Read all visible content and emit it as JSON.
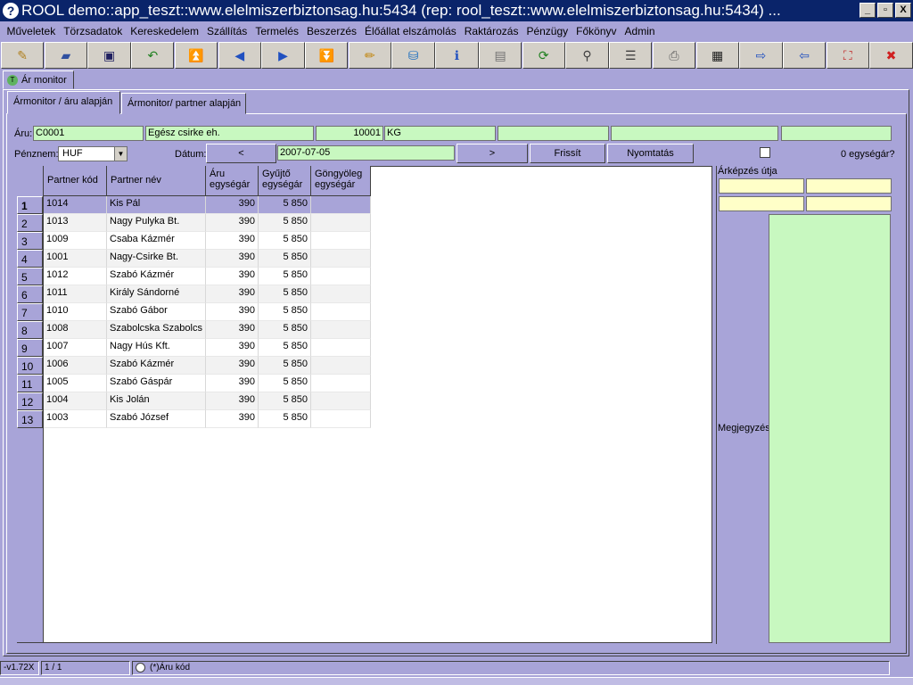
{
  "window": {
    "title": "ROOL demo::app_teszt::www.elelmiszerbiztonsag.hu:5434 (rep: rool_teszt::www.elelmiszerbiztonsag.hu:5434) ...",
    "app_icon": "?",
    "minimize": "_",
    "restore": "▫",
    "close": "X"
  },
  "menu": [
    "Műveletek",
    "Törzsadatok",
    "Kereskedelem",
    "Szállítás",
    "Termelés",
    "Beszerzés",
    "Élőállat elszámolás",
    "Raktározás",
    "Pénzügy",
    "Főkönyv",
    "Admin"
  ],
  "toolbar_icons": [
    {
      "name": "new-icon",
      "glyph": "✎",
      "color": "#b08020"
    },
    {
      "name": "open-icon",
      "glyph": "▰",
      "color": "#3050a0"
    },
    {
      "name": "save-icon",
      "glyph": "▣",
      "color": "#202060"
    },
    {
      "name": "undo-icon",
      "glyph": "↶",
      "color": "#208020"
    },
    {
      "name": "first-icon",
      "glyph": "⏫",
      "color": "#2050c0"
    },
    {
      "name": "prev-icon",
      "glyph": "◀",
      "color": "#2050c0"
    },
    {
      "name": "next-icon",
      "glyph": "▶",
      "color": "#2050c0"
    },
    {
      "name": "last-icon",
      "glyph": "⏬",
      "color": "#2050c0"
    },
    {
      "name": "edit-icon",
      "glyph": "✏",
      "color": "#c08000"
    },
    {
      "name": "database-icon",
      "glyph": "⛁",
      "color": "#2070c0"
    },
    {
      "name": "info-icon",
      "glyph": "ℹ",
      "color": "#2050c0"
    },
    {
      "name": "form-icon",
      "glyph": "▤",
      "color": "#707070"
    },
    {
      "name": "refresh-icon",
      "glyph": "⟳",
      "color": "#208020"
    },
    {
      "name": "search-icon",
      "glyph": "⚲",
      "color": "#404040"
    },
    {
      "name": "filter-icon",
      "glyph": "☰",
      "color": "#404040"
    },
    {
      "name": "print-icon",
      "glyph": "⎙",
      "color": "#606060"
    },
    {
      "name": "grid-icon",
      "glyph": "▦",
      "color": "#202020"
    },
    {
      "name": "export-icon",
      "glyph": "⇨",
      "color": "#2050c0"
    },
    {
      "name": "import-icon",
      "glyph": "⇦",
      "color": "#2050c0"
    },
    {
      "name": "fullscreen-icon",
      "glyph": "⛶",
      "color": "#c02020"
    },
    {
      "name": "exit-icon",
      "glyph": "✖",
      "color": "#d02020"
    }
  ],
  "outer_tab": {
    "label": "Ár monitor",
    "icon": "T"
  },
  "inner_tabs": [
    "Ármonitor / áru alapján",
    "Ármonitor/ partner alapján"
  ],
  "form": {
    "aru_label": "Áru:",
    "aru_code": "C0001",
    "aru_name": "Egész csirke eh.",
    "aru_qty": "10001",
    "aru_unit": "KG",
    "penznem_label": "Pénznem:",
    "penznem_value": "HUF",
    "datum_label": "Dátum:",
    "datum_value": "2007-07-05",
    "prev_label": "<",
    "next_label": ">",
    "refresh_label": "Frissít",
    "print_label": "Nyomtatás",
    "zero_label": "0 egységár?"
  },
  "grid": {
    "columns": [
      {
        "key": "kod",
        "label": "Partner kód",
        "two_line": false
      },
      {
        "key": "nev",
        "label": "Partner név",
        "two_line": false
      },
      {
        "key": "ar",
        "label": "Áru\negységár",
        "two_line": true
      },
      {
        "key": "gy",
        "label": "Gyűjtő\negységár",
        "two_line": true
      },
      {
        "key": "go",
        "label": "Göngyöleg\negységár",
        "two_line": true
      }
    ],
    "rows": [
      {
        "n": "1",
        "kod": "1014",
        "nev": "Kis Pál",
        "ar": "390",
        "gy": "5 850",
        "go": ""
      },
      {
        "n": "2",
        "kod": "1013",
        "nev": "Nagy Pulyka Bt.",
        "ar": "390",
        "gy": "5 850",
        "go": ""
      },
      {
        "n": "3",
        "kod": "1009",
        "nev": "Csaba Kázmér",
        "ar": "390",
        "gy": "5 850",
        "go": ""
      },
      {
        "n": "4",
        "kod": "1001",
        "nev": "Nagy-Csirke Bt.",
        "ar": "390",
        "gy": "5 850",
        "go": ""
      },
      {
        "n": "5",
        "kod": "1012",
        "nev": "Szabó Kázmér",
        "ar": "390",
        "gy": "5 850",
        "go": ""
      },
      {
        "n": "6",
        "kod": "1011",
        "nev": "Király Sándorné",
        "ar": "390",
        "gy": "5 850",
        "go": ""
      },
      {
        "n": "7",
        "kod": "1010",
        "nev": "Szabó Gábor",
        "ar": "390",
        "gy": "5 850",
        "go": ""
      },
      {
        "n": "8",
        "kod": "1008",
        "nev": "Szabolcska Szabolcs",
        "ar": "390",
        "gy": "5 850",
        "go": ""
      },
      {
        "n": "9",
        "kod": "1007",
        "nev": "Nagy Hús Kft.",
        "ar": "390",
        "gy": "5 850",
        "go": ""
      },
      {
        "n": "10",
        "kod": "1006",
        "nev": "Szabó Kázmér",
        "ar": "390",
        "gy": "5 850",
        "go": ""
      },
      {
        "n": "11",
        "kod": "1005",
        "nev": "Szabó Gáspár",
        "ar": "390",
        "gy": "5 850",
        "go": ""
      },
      {
        "n": "12",
        "kod": "1004",
        "nev": "Kis Jolán",
        "ar": "390",
        "gy": "5 850",
        "go": ""
      },
      {
        "n": "13",
        "kod": "1003",
        "nev": "Szabó József",
        "ar": "390",
        "gy": "5 850",
        "go": ""
      }
    ]
  },
  "right": {
    "arkepzes_label": "Árképzés útja",
    "megjegyzes_label": "Megjegyzés"
  },
  "status": {
    "version": "-v1.72X",
    "pager": "1 / 1",
    "key_label": "(*)Áru kód"
  },
  "colors": {
    "background": "#a8a4d8",
    "titlebar": "#0a246a",
    "field_green": "#c8f8c0",
    "field_yellow": "#ffffc8"
  }
}
